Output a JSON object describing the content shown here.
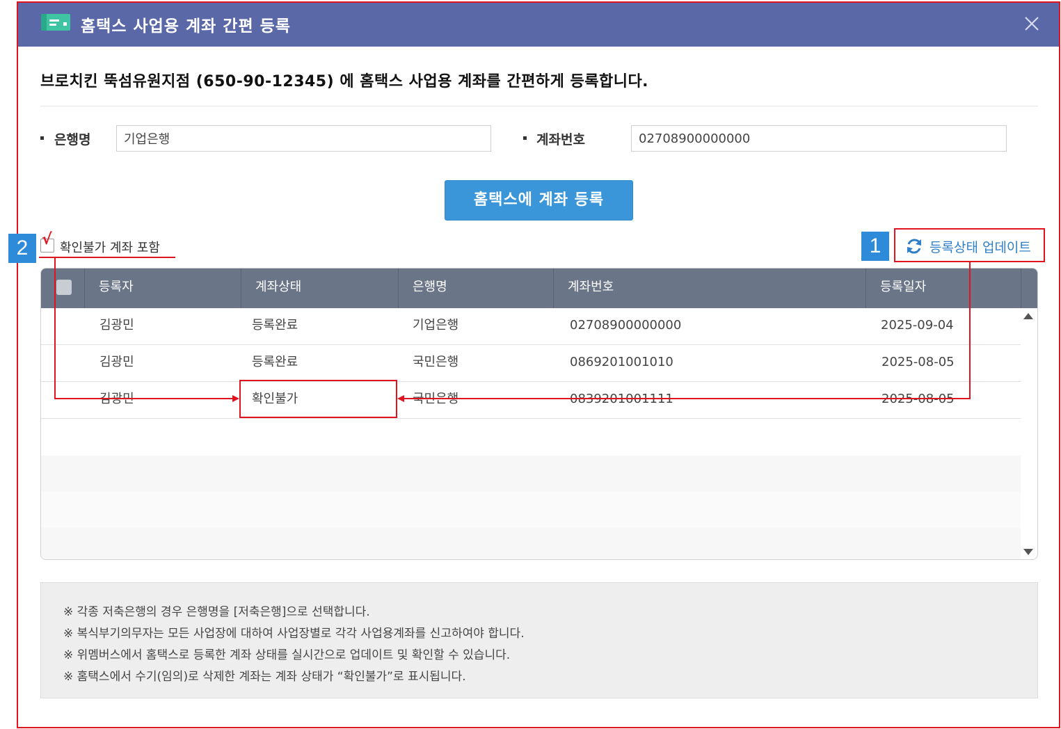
{
  "dialog": {
    "title": "홈택스 사업용 계좌 간편 등록",
    "intro": "브로치킨 뚝섬유원지점 (650-90-12345) 에 홈택스 사업용 계좌를 간편하게 등록합니다."
  },
  "form": {
    "bank_label": "은행명",
    "bank_value": "기업은행",
    "account_label": "계좌번호",
    "account_value": "02708900000000"
  },
  "register_button": "홈택스에 계좌 등록",
  "filter": {
    "include_unverified_label": "확인불가 계좌 포함",
    "include_unverified_mark": "√",
    "checked": true
  },
  "update_link": "등록상태 업데이트",
  "badges": {
    "one": "1",
    "two": "2"
  },
  "table": {
    "columns": [
      "등록자",
      "계좌상태",
      "은행명",
      "계좌번호",
      "등록일자"
    ],
    "rows": [
      {
        "registrant": "김광민",
        "status": "등록완료",
        "bank": "기업은행",
        "account": "02708900000000",
        "date": "2025-09-04"
      },
      {
        "registrant": "김광민",
        "status": "등록완료",
        "bank": "국민은행",
        "account": "0869201001010",
        "date": "2025-08-05"
      },
      {
        "registrant": "김광민",
        "status": "확인불가",
        "bank": "국민은행",
        "account": "0839201001111",
        "date": "2025-08-05"
      }
    ]
  },
  "notes": [
    "※ 각종 저축은행의 경우 은행명을 [저축은행]으로 선택합니다.",
    "※ 복식부기의무자는 모든 사업장에 대하여 사업장별로 각각 사업용계좌를 신고하여야 합니다.",
    "※ 위멤버스에서 홈택스로 등록한 계좌 상태를 실시간으로 업데이트 및 확인할 수 있습니다.",
    "※ 홈택스에서 수기(임의)로 삭제한 계좌는 계좌 상태가 “확인불가”로 표시됩니다."
  ],
  "colors": {
    "titlebar": "#5a68a8",
    "primary": "#3a96d9",
    "annotation": "#e0141e",
    "badge": "#2e8bd9",
    "table_header": "#6a7588"
  }
}
